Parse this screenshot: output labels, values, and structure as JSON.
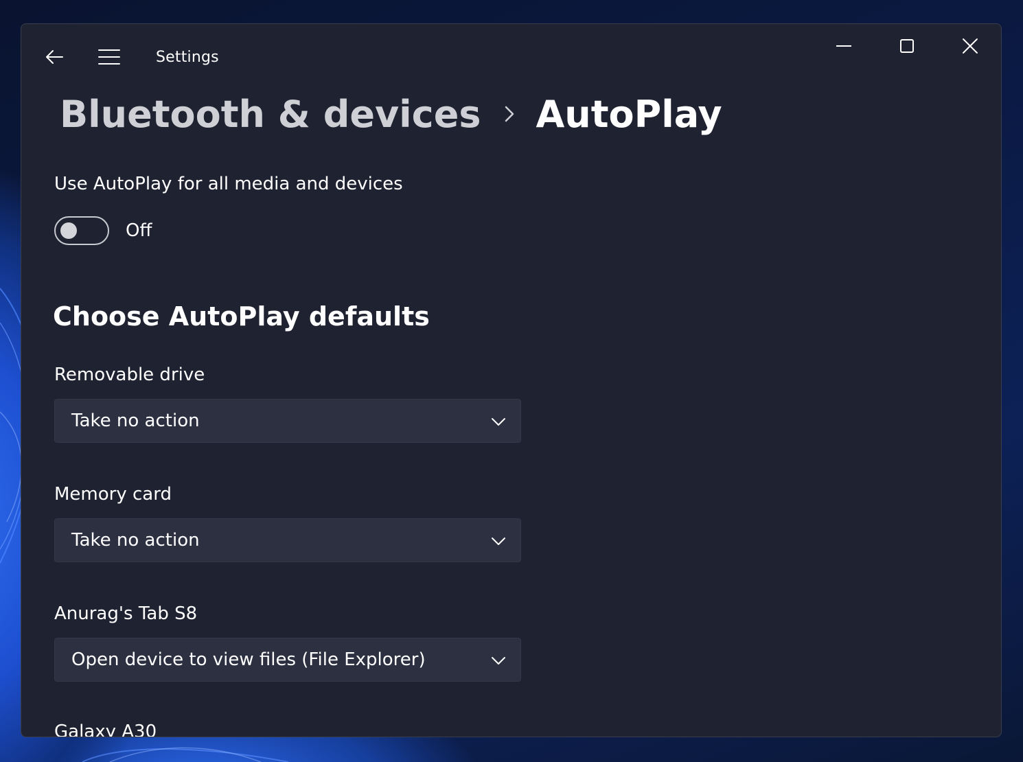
{
  "window": {
    "app_title": "Settings"
  },
  "breadcrumb": {
    "parent": "Bluetooth & devices",
    "current": "AutoPlay"
  },
  "autoplay_all": {
    "label": "Use AutoPlay for all media and devices",
    "toggle_state": "Off"
  },
  "section": {
    "title": "Choose AutoPlay defaults"
  },
  "defaults": [
    {
      "label": "Removable drive",
      "value": "Take no action"
    },
    {
      "label": "Memory card",
      "value": "Take no action"
    },
    {
      "label": "Anurag's Tab S8",
      "value": "Open device to view files (File Explorer)"
    },
    {
      "label": "Galaxy A30"
    }
  ],
  "icons": {
    "back": "back-arrow-icon",
    "menu": "hamburger-menu-icon",
    "separator": "chevron-right-icon",
    "dropdown": "chevron-down-icon",
    "minimize": "minimize-icon",
    "maximize": "maximize-icon",
    "close": "close-icon"
  },
  "colors": {
    "window_bg": "#1f2230",
    "dropdown_bg": "#2c3040",
    "text": "#ffffff",
    "parent_crumb": "#cfd0d6"
  }
}
